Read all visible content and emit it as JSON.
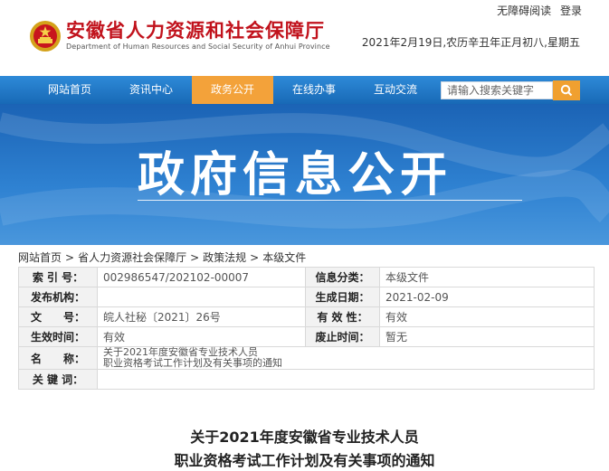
{
  "header": {
    "site_title": "安徽省人力资源和社会保障厅",
    "site_subtitle": "Department of Human Resources and Social Security of Anhui Province",
    "top_links": [
      "无障碍阅读",
      "登录"
    ],
    "date_line": "2021年2月19日,农历辛丑年正月初八,星期五"
  },
  "nav": {
    "items": [
      "网站首页",
      "资讯中心",
      "政务公开",
      "在线办事",
      "互动交流"
    ],
    "active_index": 2,
    "search_placeholder": "请输入搜索关键字"
  },
  "banner": {
    "title": "政府信息公开"
  },
  "breadcrumb": [
    "网站首页",
    "省人力资源社会保障厅",
    "政策法规",
    "本级文件"
  ],
  "meta": {
    "index_label": "索 引 号：",
    "index_value": "002986547/202102-00007",
    "category_label": "信息分类：",
    "category_value": "本级文件",
    "publisher_label": "发布机构：",
    "publisher_value": "",
    "date_label": "生成日期：",
    "date_value": "2021-02-09",
    "docno_label": "文　　号：",
    "docno_value": "皖人社秘〔2021〕26号",
    "valid_label": "有 效 性：",
    "valid_value": "有效",
    "effective_label": "生效时间：",
    "effective_value": "有效",
    "expire_label": "废止时间：",
    "expire_value": "暂无",
    "name_label": "名　　称：",
    "name_line1": "关于2021年度安徽省专业技术人员",
    "name_line2": "职业资格考试工作计划及有关事项的通知",
    "keywords_label": "关 键 词：",
    "keywords_value": ""
  },
  "document": {
    "title_line1": "关于2021年度安徽省专业技术人员",
    "title_line2": "职业资格考试工作计划及有关事项的通知"
  },
  "colors": {
    "brand_red": "#c1121c",
    "nav_blue": "#1869b6",
    "nav_active": "#f3a23a",
    "banner_blue": "#2f82d2"
  }
}
